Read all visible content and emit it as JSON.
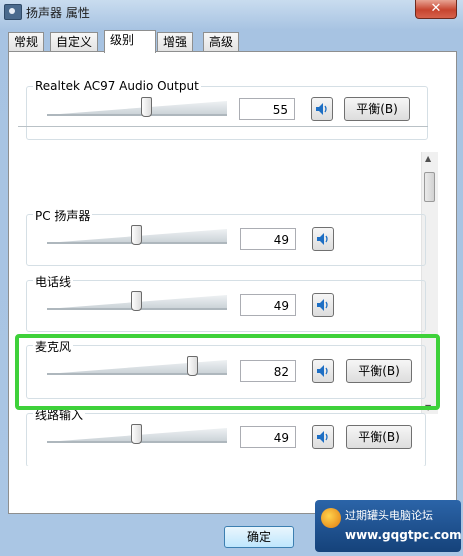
{
  "window": {
    "title": "扬声器 属性",
    "close_glyph": "✕"
  },
  "tabs": [
    {
      "label": "常规"
    },
    {
      "label": "自定义"
    },
    {
      "label": "级别",
      "active": true
    },
    {
      "label": "增强"
    },
    {
      "label": "高级"
    }
  ],
  "master": {
    "name": "Realtek AC97 Audio Output",
    "value": "55",
    "level": 0.55,
    "balance_label": "平衡(B)"
  },
  "channels": [
    {
      "name": "PC 扬声器",
      "value": "49",
      "level": 0.49,
      "has_balance": false
    },
    {
      "name": "电话线",
      "value": "49",
      "level": 0.49,
      "has_balance": false
    },
    {
      "name": "麦克风",
      "value": "82",
      "level": 0.82,
      "has_balance": true,
      "balance_label": "平衡(B)",
      "highlighted": true
    },
    {
      "name": "线路输入",
      "value": "49",
      "level": 0.49,
      "has_balance": true,
      "balance_label": "平衡(B)"
    }
  ],
  "footer": {
    "ok_label": "确定"
  },
  "watermark": {
    "line1": "过期罐头电脑论坛",
    "line2": "www.gqgtpc.com"
  },
  "colors": {
    "highlight": "#3ed13a",
    "speaker_icon": "#1e6fc4"
  }
}
